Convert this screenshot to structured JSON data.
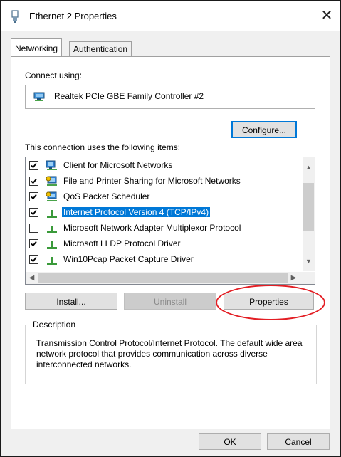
{
  "window": {
    "title": "Ethernet 2 Properties",
    "close_glyph": "✕"
  },
  "tabs": [
    {
      "label": "Networking",
      "active": true
    },
    {
      "label": "Authentication",
      "active": false
    }
  ],
  "networking": {
    "connect_using_label": "Connect using:",
    "adapter_name": "Realtek PCIe GBE Family Controller #2",
    "configure_label": "Configure...",
    "items_label": "This connection uses the following items:",
    "items": [
      {
        "label": "Client for Microsoft Networks",
        "checked": true,
        "icon": "network-client-icon",
        "selected": false
      },
      {
        "label": "File and Printer Sharing for Microsoft Networks",
        "checked": true,
        "icon": "network-service-icon",
        "selected": false
      },
      {
        "label": "QoS Packet Scheduler",
        "checked": true,
        "icon": "network-service-icon",
        "selected": false
      },
      {
        "label": "Internet Protocol Version 4 (TCP/IPv4)",
        "checked": true,
        "icon": "protocol-icon",
        "selected": true
      },
      {
        "label": "Microsoft Network Adapter Multiplexor Protocol",
        "checked": false,
        "icon": "protocol-icon",
        "selected": false
      },
      {
        "label": "Microsoft LLDP Protocol Driver",
        "checked": true,
        "icon": "protocol-icon",
        "selected": false
      },
      {
        "label": "Win10Pcap Packet Capture Driver",
        "checked": true,
        "icon": "protocol-icon",
        "selected": false
      }
    ],
    "install_label": "Install...",
    "uninstall_label": "Uninstall",
    "properties_label": "Properties",
    "description_title": "Description",
    "description_text": "Transmission Control Protocol/Internet Protocol. The default wide area network protocol that provides communication across diverse interconnected networks."
  },
  "footer": {
    "ok_label": "OK",
    "cancel_label": "Cancel"
  },
  "colors": {
    "selection": "#0078d7",
    "highlight_annotation": "#e31e24"
  }
}
